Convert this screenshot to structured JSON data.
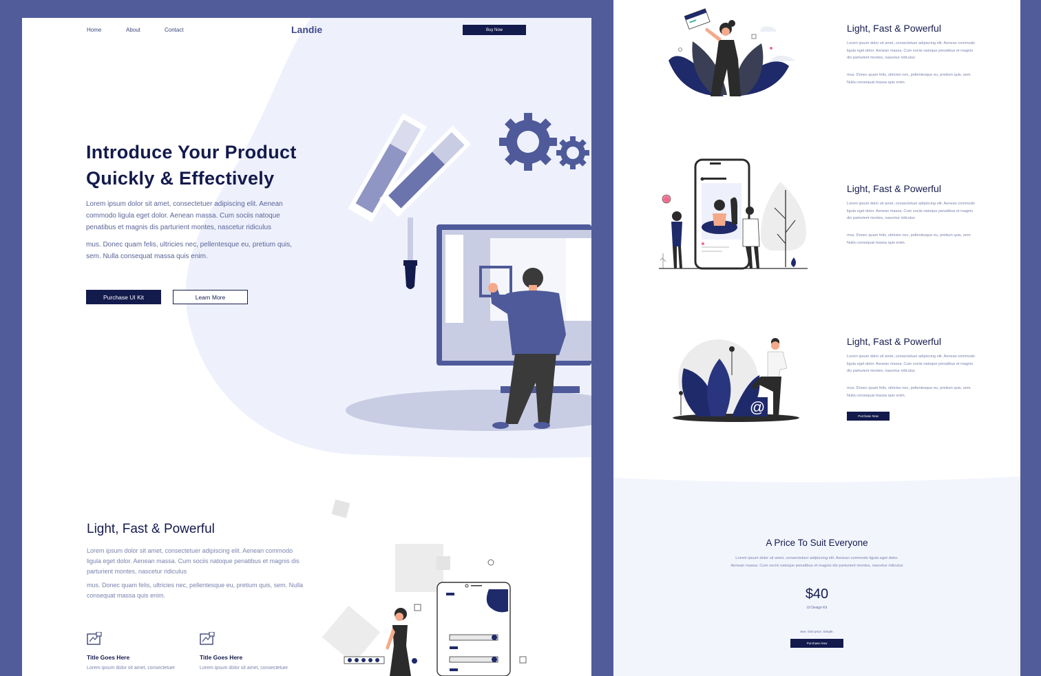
{
  "nav": {
    "links": [
      "Home",
      "About",
      "Contact"
    ],
    "logo": "Landie",
    "buy_label": "Buy Now"
  },
  "hero": {
    "title_line1": "Introduce Your Product",
    "title_line2": "Quickly & Effectively",
    "para1": "Lorem ipsum dolor sit amet, consectetuer adipiscing elit. Aenean commodo ligula eget dolor. Aenean massa. Cum sociis natoque penatibus et magnis dis parturient montes, nascetur ridiculus",
    "para2": "mus. Donec quam felis, ultricies nec, pellentesque eu, pretium quis, sem. Nulla consequat massa quis enim.",
    "primary_label": "Purchase UI Kit",
    "secondary_label": "Learn More"
  },
  "features": {
    "title": "Light, Fast & Powerful",
    "para1": "Lorem ipsum dolor sit amet, consectetuer adipiscing elit. Aenean commodo ligula eget dolor. Aenean massa. Cum sociis natoque penatibus et magnis dis parturient montes, nascetur ridiculus",
    "para2": "mus. Donec quam felis, ultricies nec, pellentesque eu, pretium quis, sem. Nulla consequat massa quis enim.",
    "items": [
      {
        "title": "Title Goes Here",
        "text": "Lorem ipsum dolor sit amet, consectetuer"
      },
      {
        "title": "Title Goes Here",
        "text": "Lorem ipsum dolor sit amet, consectetuer"
      }
    ]
  },
  "right_sections": [
    {
      "title": "Light, Fast & Powerful",
      "para1": "Lorem ipsum dolor sit amet, consectetuer adipiscing elit. Aenean commodo ligula eget dolor. Aenean massa. Cum sociis natoque penatibus et magnis dis parturient montes, nascetur ridiculus",
      "para2": "mus. Donec quam felis, ultricies nec, pellentesque eu, pretium quis, sem. Nulla consequat massa quis enim."
    },
    {
      "title": "Light, Fast & Powerful",
      "para1": "Lorem ipsum dolor sit amet, consectetuer adipiscing elit. Aenean commodo ligula eget dolor. Aenean massa. Cum sociis natoque penatibus et magnis dis parturient montes, nascetur ridiculus",
      "para2": "mus. Donec quam felis, ultricies nec, pellentesque eu, pretium quis, sem. Nulla consequat massa quis enim."
    },
    {
      "title": "Light, Fast & Powerful",
      "para1": "Lorem ipsum dolor sit amet, consectetuer adipiscing elit. Aenean commodo ligula eget dolor. Aenean massa. Cum sociis natoque penatibus et magnis dis parturient montes, nascetur ridiculus",
      "para2": "mus. Donec quam felis, ultricies nec, pellentesque eu, pretium quis, sem. Nulla consequat massa quis enim.",
      "button_label": "Purchase Now"
    }
  ],
  "pricing": {
    "title": "A Price To Suit Everyone",
    "text": "Lorem ipsum dolor sit amet, consectetuer adipiscing elit. Aenean commodo ligula eget dolor. Aenean massa. Cum sociis natoque penatibus et magnis dis parturient montes, nascetur ridiculus",
    "price": "$40",
    "price_caption": "UI Design Kit",
    "note": "See, One price. Simple.",
    "button_label": "Purchase Now"
  },
  "colors": {
    "frame_bg": "#515c9b",
    "navy": "#131a4c",
    "accent": "#4f5a9a",
    "tint": "#eef1fc"
  }
}
